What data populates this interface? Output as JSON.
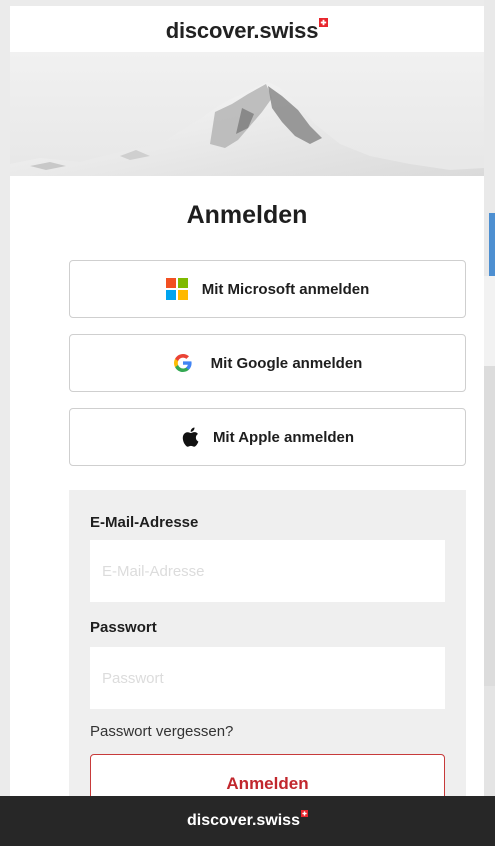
{
  "brand": {
    "logo_text": "discover.swiss",
    "flag_color": "#e8262d"
  },
  "page": {
    "title": "Anmelden"
  },
  "sso": [
    {
      "label": "Mit Microsoft anmelden",
      "icon": "microsoft-icon"
    },
    {
      "label": "Mit Google anmelden",
      "icon": "google-icon"
    },
    {
      "label": "Mit Apple anmelden",
      "icon": "apple-icon"
    }
  ],
  "form": {
    "email_label": "E-Mail-Adresse",
    "email_placeholder": "E-Mail-Adresse",
    "email_value": "",
    "password_label": "Passwort",
    "password_placeholder": "Passwort",
    "password_value": "",
    "forgot_link": "Passwort vergessen?",
    "submit_label": "Anmelden"
  },
  "footer": {
    "logo_text": "discover.swiss"
  },
  "colors": {
    "accent": "#c1272d",
    "footer_bg": "#272727",
    "form_bg": "#efefef"
  }
}
